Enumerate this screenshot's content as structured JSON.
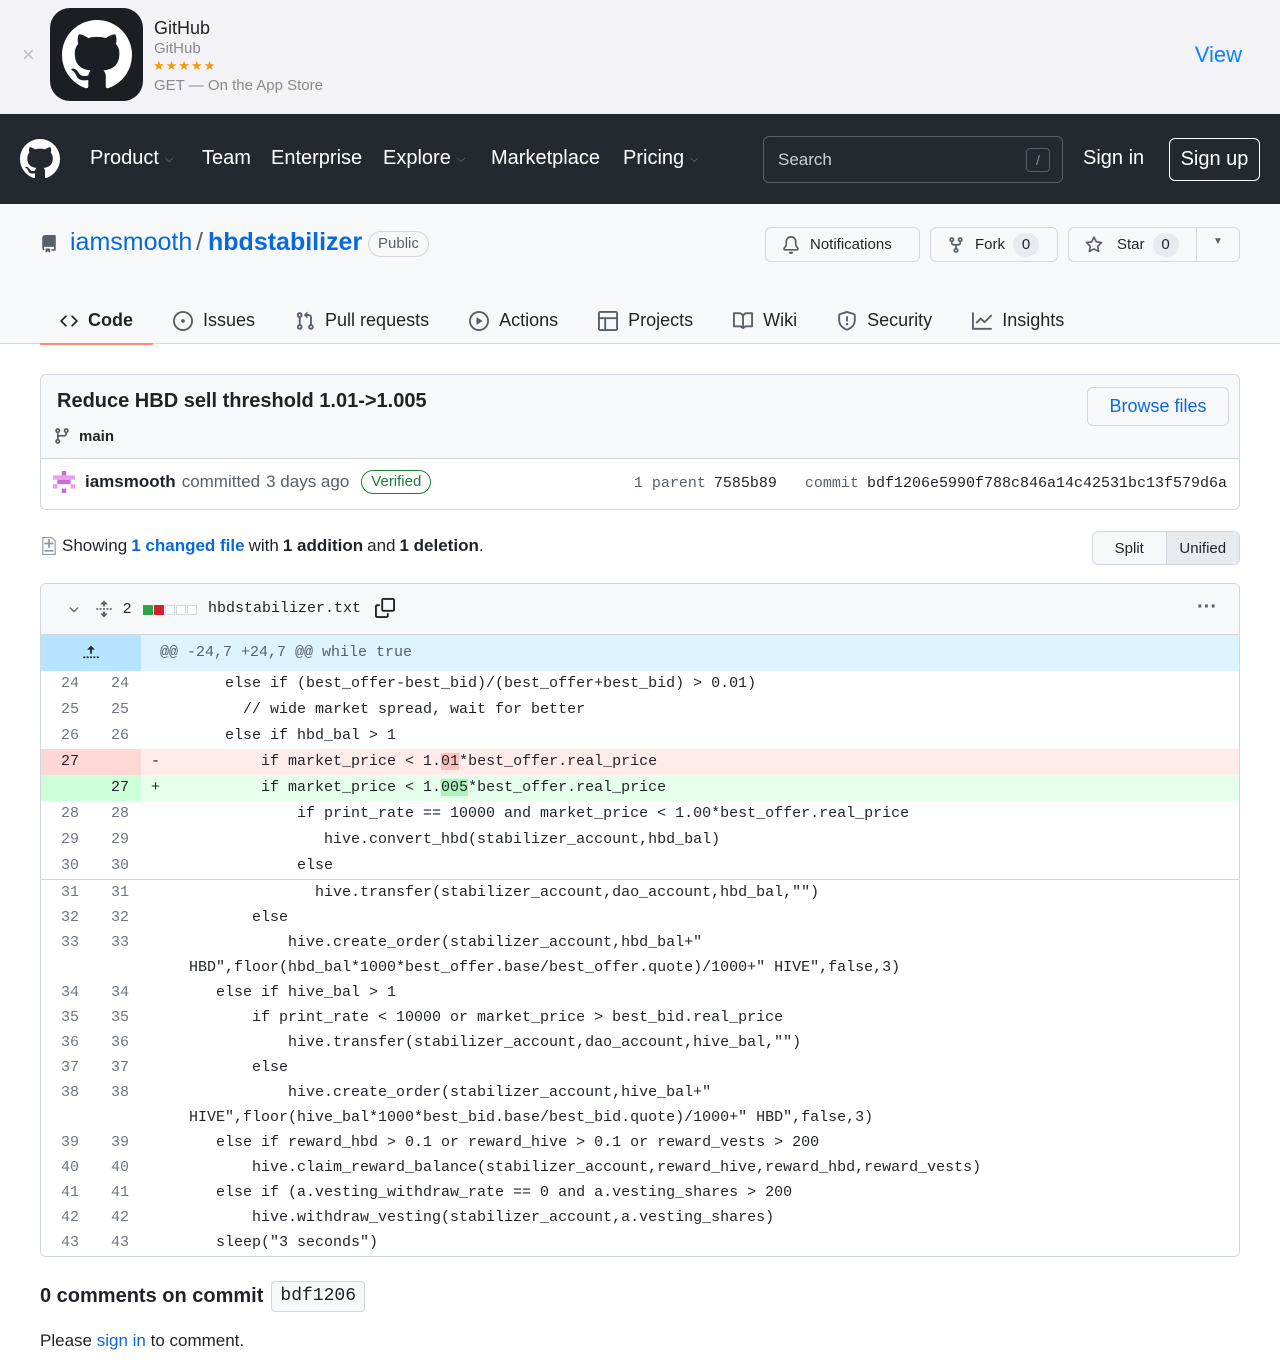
{
  "app_banner": {
    "close": "×",
    "name": "GitHub",
    "publisher": "GitHub",
    "stars": "★★★★★",
    "get_text": "GET — On the App Store",
    "view": "View"
  },
  "header": {
    "nav": [
      "Product",
      "Team",
      "Enterprise",
      "Explore",
      "Marketplace",
      "Pricing"
    ],
    "search_placeholder": "Search",
    "search_key": "/",
    "sign_in": "Sign in",
    "sign_up": "Sign up"
  },
  "repo": {
    "owner": "iamsmooth",
    "slash": "/",
    "name": "hbdstabilizer",
    "visibility": "Public",
    "notifications": "Notifications",
    "fork": "Fork",
    "fork_count": "0",
    "star": "Star",
    "star_count": "0"
  },
  "tabs": [
    "Code",
    "Issues",
    "Pull requests",
    "Actions",
    "Projects",
    "Wiki",
    "Security",
    "Insights"
  ],
  "commit": {
    "title": "Reduce HBD sell threshold 1.01->1.005",
    "branch": "main",
    "browse": "Browse files",
    "author": "iamsmooth",
    "committed": "committed",
    "when": "3 days ago",
    "verified": "Verified",
    "parent_label": "1 parent",
    "parent_sha": "7585b89",
    "commit_label": "commit",
    "commit_sha": "bdf1206e5990f788c846a14c42531bc13f579d6a"
  },
  "summary": {
    "showing": "Showing",
    "changed": "1 changed file",
    "with": "with",
    "additions": "1 addition",
    "and": "and",
    "deletions": "1 deletion",
    "period": ".",
    "split": "Split",
    "unified": "Unified"
  },
  "file": {
    "changes": "2",
    "name": "hbdstabilizer.txt",
    "menu": "···",
    "hunk": "@@ -24,7 +24,7 @@ while true"
  },
  "diff_lines": [
    {
      "type": "ctx",
      "old": "24",
      "new": "24",
      "text": "      else if (best_offer-best_bid)/(best_offer+best_bid) > 0.01)"
    },
    {
      "type": "ctx",
      "old": "25",
      "new": "25",
      "text": "        // wide market spread, wait for better"
    },
    {
      "type": "ctx",
      "old": "26",
      "new": "26",
      "text": "      else if hbd_bal > 1"
    },
    {
      "type": "del",
      "old": "27",
      "new": "",
      "sign": "-",
      "pre": "          if market_price < 1.",
      "hl": "01",
      "post": "*best_offer.real_price"
    },
    {
      "type": "add",
      "old": "",
      "new": "27",
      "sign": "+",
      "pre": "          if market_price < 1.",
      "hl": "005",
      "post": "*best_offer.real_price"
    },
    {
      "type": "ctx",
      "old": "28",
      "new": "28",
      "text": "              if print_rate == 10000 and market_price < 1.00*best_offer.real_price"
    },
    {
      "type": "ctx",
      "old": "29",
      "new": "29",
      "text": "                 hive.convert_hbd(stabilizer_account,hbd_bal)"
    },
    {
      "type": "ctx",
      "old": "30",
      "new": "30",
      "text": "              else"
    },
    {
      "type": "sep"
    },
    {
      "type": "ctx",
      "old": "31",
      "new": "31",
      "text": "                hive.transfer(stabilizer_account,dao_account,hbd_bal,\"\")"
    },
    {
      "type": "ctx",
      "old": "32",
      "new": "32",
      "text": "         else"
    },
    {
      "type": "ctx",
      "old": "33",
      "new": "33",
      "text": "             hive.create_order(stabilizer_account,hbd_bal+\""
    },
    {
      "type": "ctx",
      "old": "",
      "new": "",
      "text": "  HBD\",floor(hbd_bal*1000*best_offer.base/best_offer.quote)/1000+\" HIVE\",false,3)"
    },
    {
      "type": "ctx",
      "old": "34",
      "new": "34",
      "text": "     else if hive_bal > 1"
    },
    {
      "type": "ctx",
      "old": "35",
      "new": "35",
      "text": "         if print_rate < 10000 or market_price > best_bid.real_price"
    },
    {
      "type": "ctx",
      "old": "36",
      "new": "36",
      "text": "             hive.transfer(stabilizer_account,dao_account,hive_bal,\"\")"
    },
    {
      "type": "ctx",
      "old": "37",
      "new": "37",
      "text": "         else"
    },
    {
      "type": "ctx",
      "old": "38",
      "new": "38",
      "text": "             hive.create_order(stabilizer_account,hive_bal+\""
    },
    {
      "type": "ctx",
      "old": "",
      "new": "",
      "text": "  HIVE\",floor(hive_bal*1000*best_bid.base/best_bid.quote)/1000+\" HBD\",false,3)"
    },
    {
      "type": "ctx",
      "old": "39",
      "new": "39",
      "text": "     else if reward_hbd > 0.1 or reward_hive > 0.1 or reward_vests > 200"
    },
    {
      "type": "ctx",
      "old": "40",
      "new": "40",
      "text": "         hive.claim_reward_balance(stabilizer_account,reward_hive,reward_hbd,reward_vests)"
    },
    {
      "type": "ctx",
      "old": "41",
      "new": "41",
      "text": "     else if (a.vesting_withdraw_rate == 0 and a.vesting_shares > 200"
    },
    {
      "type": "ctx",
      "old": "42",
      "new": "42",
      "text": "         hive.withdraw_vesting(stabilizer_account,a.vesting_shares)"
    },
    {
      "type": "ctx",
      "old": "43",
      "new": "43",
      "text": "     sleep(\"3 seconds\")"
    }
  ],
  "comments": {
    "title": "0 comments on commit",
    "sha": "bdf1206",
    "please": "Please",
    "sign_in": "sign in",
    "to_comment": "to comment."
  },
  "colors": {
    "header_bg": "#24292f",
    "link": "#0969da",
    "active_tab": "#fd8c73",
    "verified": "#1a7f37",
    "deletion_bg": "#ffebe9",
    "addition_bg": "#e6ffec"
  }
}
